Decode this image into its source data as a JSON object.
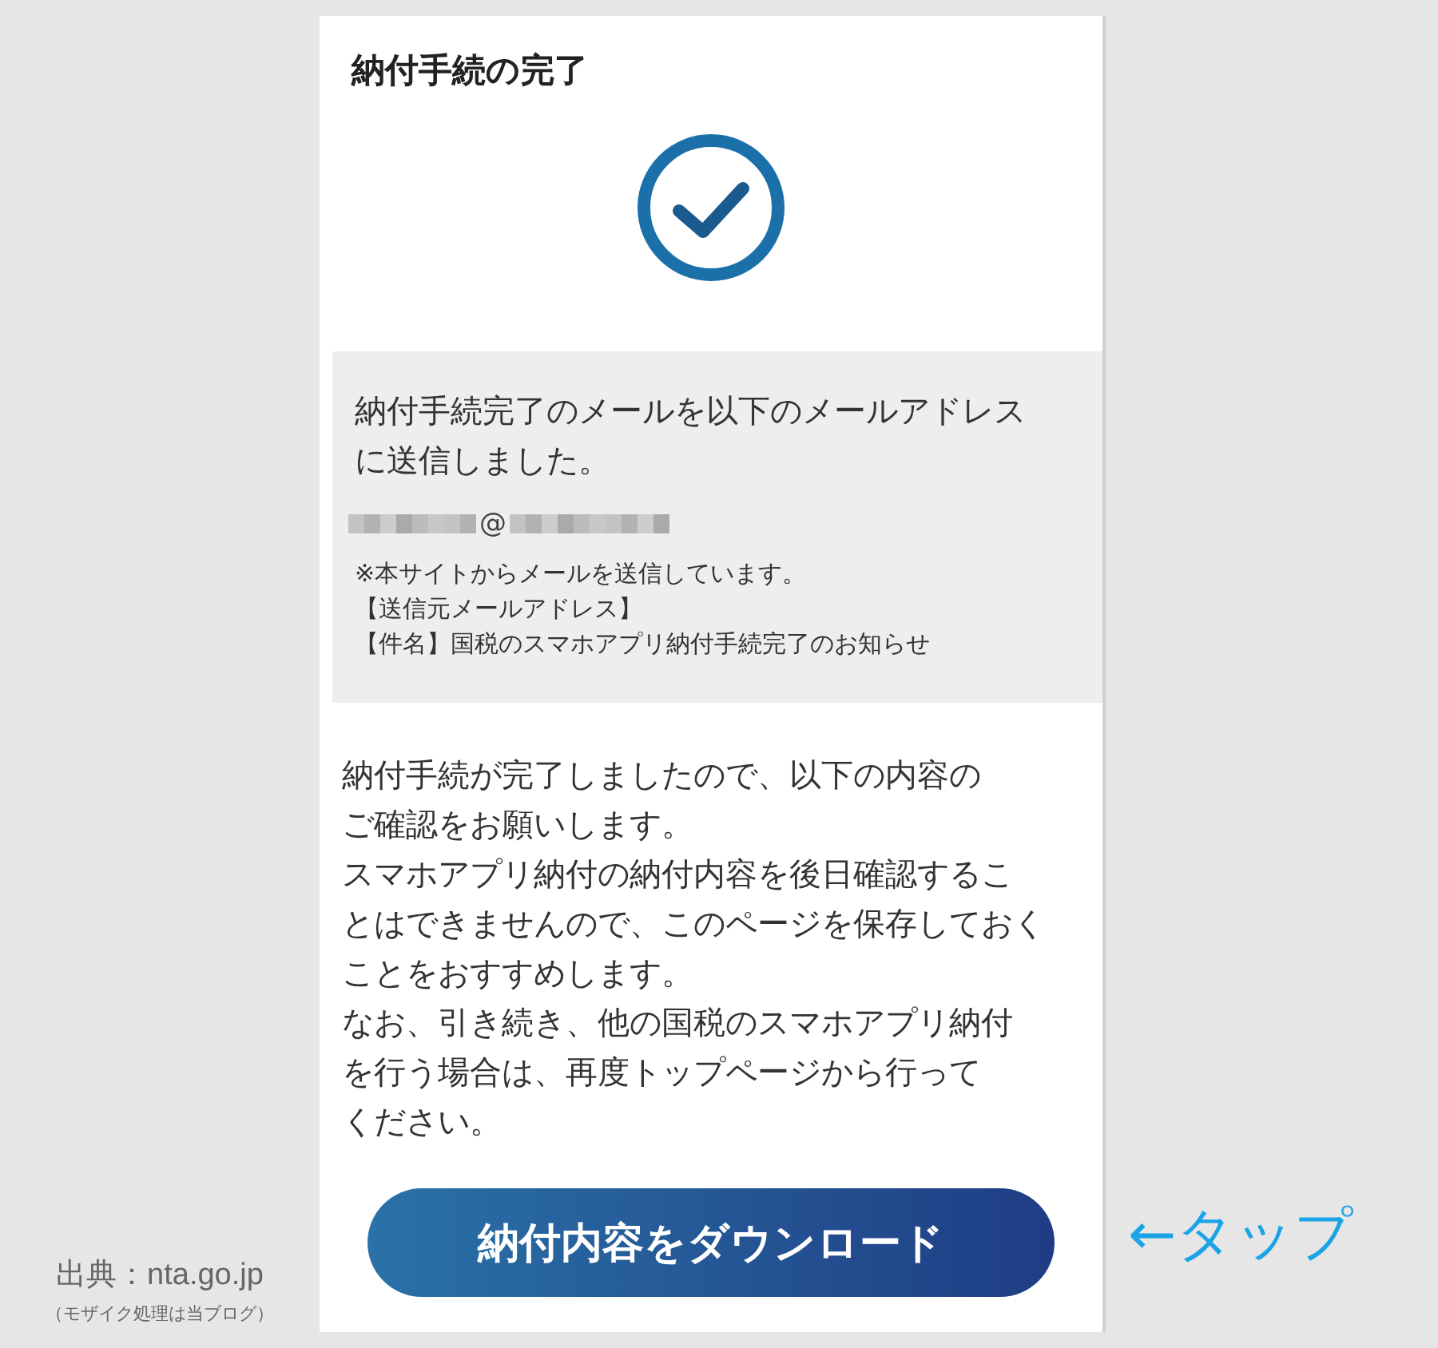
{
  "title": "納付手続の完了",
  "notice": {
    "lines": [
      "納付手続完了のメールを以下のメールアドレス",
      "に送信しました。"
    ],
    "email_at": "@",
    "notes": [
      "※本サイトからメールを送信しています。",
      "【送信元メールアドレス】",
      "【件名】国税のスマホアプリ納付手続完了のお知らせ"
    ]
  },
  "body_lines": [
    "納付手続が完了しましたので、以下の内容の",
    "ご確認をお願いします。",
    "スマホアプリ納付の納付内容を後日確認するこ",
    "とはできませんので、このページを保存しておく",
    "ことをおすすめします。",
    "なお、引き続き、他の国税のスマホアプリ納付",
    "を行う場合は、再度トップページから行って",
    "ください。"
  ],
  "download_button": "納付内容をダウンロード",
  "source": {
    "label": "出典：nta.go.jp",
    "note": "（モザイク処理は当ブログ）"
  },
  "tap_hint": "←タップ"
}
